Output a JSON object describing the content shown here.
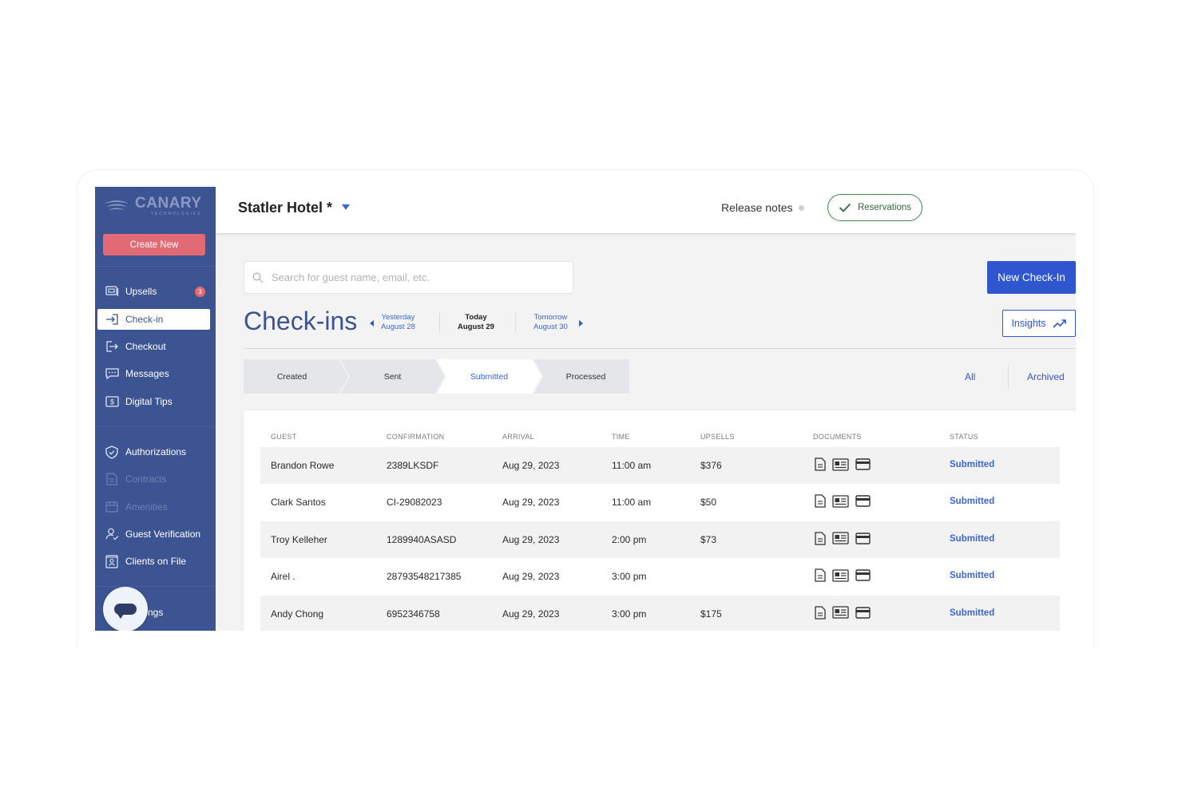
{
  "sidebar": {
    "logo": {
      "name": "CANARY",
      "sub": "TECHNOLOGIES"
    },
    "create_new": "Create New",
    "items": [
      {
        "label": "Upsells",
        "icon": "upsells-icon",
        "badge": "3"
      },
      {
        "label": "Check-in",
        "icon": "check-in-icon",
        "active": true
      },
      {
        "label": "Checkout",
        "icon": "checkout-icon"
      },
      {
        "label": "Messages",
        "icon": "messages-icon"
      },
      {
        "label": "Digital Tips",
        "icon": "dollar-icon"
      },
      {
        "label": "Authorizations",
        "icon": "shield-check-icon"
      },
      {
        "label": "Contracts",
        "icon": "document-icon",
        "disabled": true
      },
      {
        "label": "Amenities",
        "icon": "amenities-icon",
        "disabled": true
      },
      {
        "label": "Guest Verification",
        "icon": "user-check-icon"
      },
      {
        "label": "Clients on File",
        "icon": "id-card-icon"
      }
    ],
    "settings_partial": "ngs"
  },
  "topbar": {
    "hotel": "Statler Hotel *",
    "release_notes": "Release notes",
    "reservations": "Reservations"
  },
  "main": {
    "search_placeholder": "Search for guest name, email, etc.",
    "new_checkin": "New Check-In",
    "title": "Check-ins",
    "dates": {
      "prev": {
        "label": "Yesterday",
        "date": "August 28"
      },
      "current": {
        "label": "Today",
        "date": "August 29"
      },
      "next": {
        "label": "Tomorrow",
        "date": "August 30"
      }
    },
    "insights": "Insights",
    "steps": [
      "Created",
      "Sent",
      "Submitted",
      "Processed"
    ],
    "active_step": "Submitted",
    "filters": [
      "All",
      "Archived"
    ]
  },
  "table": {
    "headers": [
      "GUEST",
      "CONFIRMATION",
      "ARRIVAL",
      "TIME",
      "UPSELLS",
      "DOCUMENTS",
      "STATUS"
    ],
    "rows": [
      {
        "guest": "Brandon Rowe",
        "confirmation": "2389LKSDF",
        "arrival": "Aug 29, 2023",
        "time": "11:00 am",
        "upsells": "$376",
        "status": "Submitted"
      },
      {
        "guest": "Clark Santos",
        "confirmation": "CI-29082023",
        "arrival": "Aug 29, 2023",
        "time": "11:00 am",
        "upsells": "$50",
        "status": "Submitted"
      },
      {
        "guest": "Troy Kelleher",
        "confirmation": "1289940ASASD",
        "arrival": "Aug 29, 2023",
        "time": "2:00 pm",
        "upsells": "$73",
        "status": "Submitted"
      },
      {
        "guest": "Airel .",
        "confirmation": "28793548217385",
        "arrival": "Aug 29, 2023",
        "time": "3:00 pm",
        "upsells": "",
        "status": "Submitted"
      },
      {
        "guest": "Andy Chong",
        "confirmation": "6952346758",
        "arrival": "Aug 29, 2023",
        "time": "3:00 pm",
        "upsells": "$175",
        "status": "Submitted"
      }
    ]
  },
  "colors": {
    "sidebar": "#3d5493",
    "primary": "#2f56cf",
    "create": "#e26a74",
    "reservations_border": "#3b8a4c"
  }
}
